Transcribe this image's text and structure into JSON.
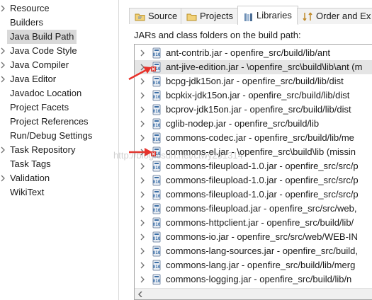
{
  "left_tree": {
    "items": [
      {
        "label": "Resource",
        "expandable": true
      },
      {
        "label": "Builders",
        "expandable": false
      },
      {
        "label": "Java Build Path",
        "expandable": false,
        "selected": true
      },
      {
        "label": "Java Code Style",
        "expandable": true
      },
      {
        "label": "Java Compiler",
        "expandable": true
      },
      {
        "label": "Java Editor",
        "expandable": true
      },
      {
        "label": "Javadoc Location",
        "expandable": false
      },
      {
        "label": "Project Facets",
        "expandable": false
      },
      {
        "label": "Project References",
        "expandable": false
      },
      {
        "label": "Run/Debug Settings",
        "expandable": false
      },
      {
        "label": "Task Repository",
        "expandable": true
      },
      {
        "label": "Task Tags",
        "expandable": false
      },
      {
        "label": "Validation",
        "expandable": true
      },
      {
        "label": "WikiText",
        "expandable": false
      }
    ]
  },
  "tabs": [
    {
      "label": "Source",
      "icon": "source-folder-icon",
      "active": false
    },
    {
      "label": "Projects",
      "icon": "projects-icon",
      "active": false
    },
    {
      "label": "Libraries",
      "icon": "libraries-icon",
      "active": true
    },
    {
      "label": "Order and Ex",
      "icon": "order-export-icon",
      "active": false
    }
  ],
  "build_path_label": "JARs and class folders on the build path:",
  "jars": [
    {
      "text": "ant-contrib.jar - openfire_src/build/lib/ant",
      "missing": false
    },
    {
      "text": "ant-jive-edition.jar - \\openfire_src\\build\\lib\\ant (m",
      "missing": true,
      "selected": true
    },
    {
      "text": "bcpg-jdk15on.jar - openfire_src/build/lib/dist",
      "missing": false
    },
    {
      "text": "bcpkix-jdk15on.jar - openfire_src/build/lib/dist",
      "missing": false
    },
    {
      "text": "bcprov-jdk15on.jar - openfire_src/build/lib/dist",
      "missing": false
    },
    {
      "text": "cglib-nodep.jar - openfire_src/build/lib",
      "missing": false
    },
    {
      "text": "commons-codec.jar - openfire_src/build/lib/me",
      "missing": false
    },
    {
      "text": "commons-el.jar - \\openfire_src\\build\\lib (missin",
      "missing": true
    },
    {
      "text": "commons-fileupload-1.0.jar - openfire_src/src/p",
      "missing": false
    },
    {
      "text": "commons-fileupload-1.0.jar - openfire_src/src/p",
      "missing": false
    },
    {
      "text": "commons-fileupload-1.0.jar - openfire_src/src/p",
      "missing": false
    },
    {
      "text": "commons-fileupload.jar - openfire_src/src/web,",
      "missing": false
    },
    {
      "text": "commons-httpclient.jar - openfire_src/build/lib/",
      "missing": false
    },
    {
      "text": "commons-io.jar - openfire_src/src/web/WEB-IN",
      "missing": false
    },
    {
      "text": "commons-lang-sources.jar - openfire_src/build,",
      "missing": false
    },
    {
      "text": "commons-lang.jar - openfire_src/build/lib/merg",
      "missing": false
    },
    {
      "text": "commons-logging.jar - openfire_src/build/lib/n",
      "missing": false
    }
  ],
  "colors": {
    "annotation_arrow": "#e8322b",
    "jar_icon_blue": "#3b6ea5",
    "error_badge": "#d9342b"
  },
  "watermark": "http://blog.csdn.net/ctwy291314"
}
